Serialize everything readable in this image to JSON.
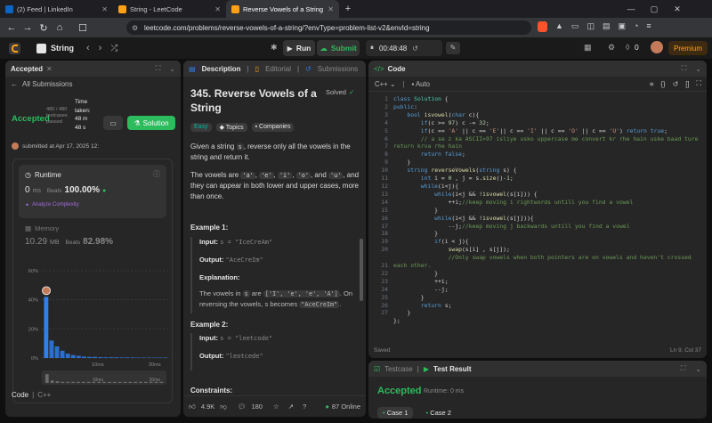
{
  "browser": {
    "tabs": [
      {
        "title": "(2) Feed | LinkedIn",
        "favicon_color": "#0a66c2"
      },
      {
        "title": "String - LeetCode",
        "favicon_color": "#ffa116"
      },
      {
        "title": "Reverse Vowels of a String - Le",
        "favicon_color": "#ffa116"
      }
    ],
    "url": "leetcode.com/problems/reverse-vowels-of-a-string/?envType=problem-list-v2&envId=string"
  },
  "lc_top": {
    "list_name": "String",
    "run_label": "Run",
    "submit_label": "Submit",
    "timer": "00:48:48",
    "fire_count": "0",
    "premium_label": "Premium"
  },
  "left": {
    "tab_label": "Accepted",
    "back_label": "All Submissions",
    "status": "Accepted",
    "testcases": "480 / 480 testcases passed",
    "time_taken_label": "Time taken:",
    "time_taken_value": "48 m 48 s",
    "solution_label": "Solution",
    "submitted_text": "submitted at Apr 17, 2025 12:",
    "runtime_label": "Runtime",
    "runtime_value": "0",
    "runtime_unit": "ms",
    "beats_label": "Beats",
    "runtime_beats": "100.00%",
    "analyze_label": "Analyze Complexity",
    "memory_label": "Memory",
    "memory_value": "10.29",
    "memory_unit": "MB",
    "memory_beats_label": "Beats",
    "memory_beats": "82.98%",
    "chart_y_ticks": [
      "60%",
      "40%",
      "20%",
      "0%"
    ],
    "chart_x_ticks": [
      "10ms",
      "20ms"
    ],
    "mini_x_ticks": [
      "10ms",
      "20ms"
    ],
    "code_label": "Code",
    "lang_label": "C++"
  },
  "chart_data": {
    "type": "bar",
    "title": "",
    "xlabel": "",
    "ylabel": "",
    "ylim": [
      0,
      60
    ],
    "y_ticks": [
      "60%",
      "40%",
      "20%",
      "0%"
    ],
    "x_ticks": [
      "10ms",
      "20ms"
    ],
    "values": [
      42,
      12,
      8,
      5,
      3,
      2,
      1.5,
      1,
      0.8,
      0.8,
      0.6,
      0.5,
      0.5,
      0.5,
      0.4,
      0.4,
      0.4,
      0.3,
      0.3,
      0.3,
      0.3,
      0.3,
      0.3
    ]
  },
  "desc": {
    "tabs": [
      "Description",
      "Editorial",
      "Submissions"
    ],
    "title": "345. Reverse Vowels of a String",
    "solved_label": "Solved",
    "difficulty": "Easy",
    "topics_label": "Topics",
    "companies_label": "Companies",
    "p1_a": "Given a string",
    "p1_code": "s",
    "p1_b": ", reverse only all the vowels in the string and return it.",
    "p2_a": "The vowels are",
    "vowels": [
      "'a'",
      "'e'",
      "'i'",
      "'o'",
      "'u'"
    ],
    "p2_and": "and",
    "p2_b": ", and they can appear in both lower and upper cases, more than once.",
    "ex1_title": "Example 1:",
    "input_label": "Input:",
    "ex1_input": "s = \"IceCreAm\"",
    "output_label": "Output:",
    "ex1_output": "\"AceCreIm\"",
    "explanation_label": "Explanation:",
    "exp_a": "The vowels in",
    "exp_code": "s",
    "exp_are": "are",
    "exp_list": "['I', 'e', 'e', 'A']",
    "exp_b": ". On reversing the vowels, s becomes",
    "exp_result": "\"AceCreIm\"",
    "ex2_title": "Example 2:",
    "ex2_input": "s = \"leetcode\"",
    "ex2_output": "\"leotcede\"",
    "constraints_label": "Constraints:",
    "likes": "4.9K",
    "comments": "180",
    "online": "87 Online"
  },
  "code": {
    "tab_label": "Code",
    "lang": "C++",
    "auto_label": "Auto",
    "saved_label": "Saved",
    "cursor_pos": "Ln 9, Col 37"
  },
  "result": {
    "testcase_tab": "Testcase",
    "result_tab": "Test Result",
    "status": "Accepted",
    "runtime": "Runtime: 0 ms",
    "cases": [
      "Case 1",
      "Case 2"
    ]
  }
}
